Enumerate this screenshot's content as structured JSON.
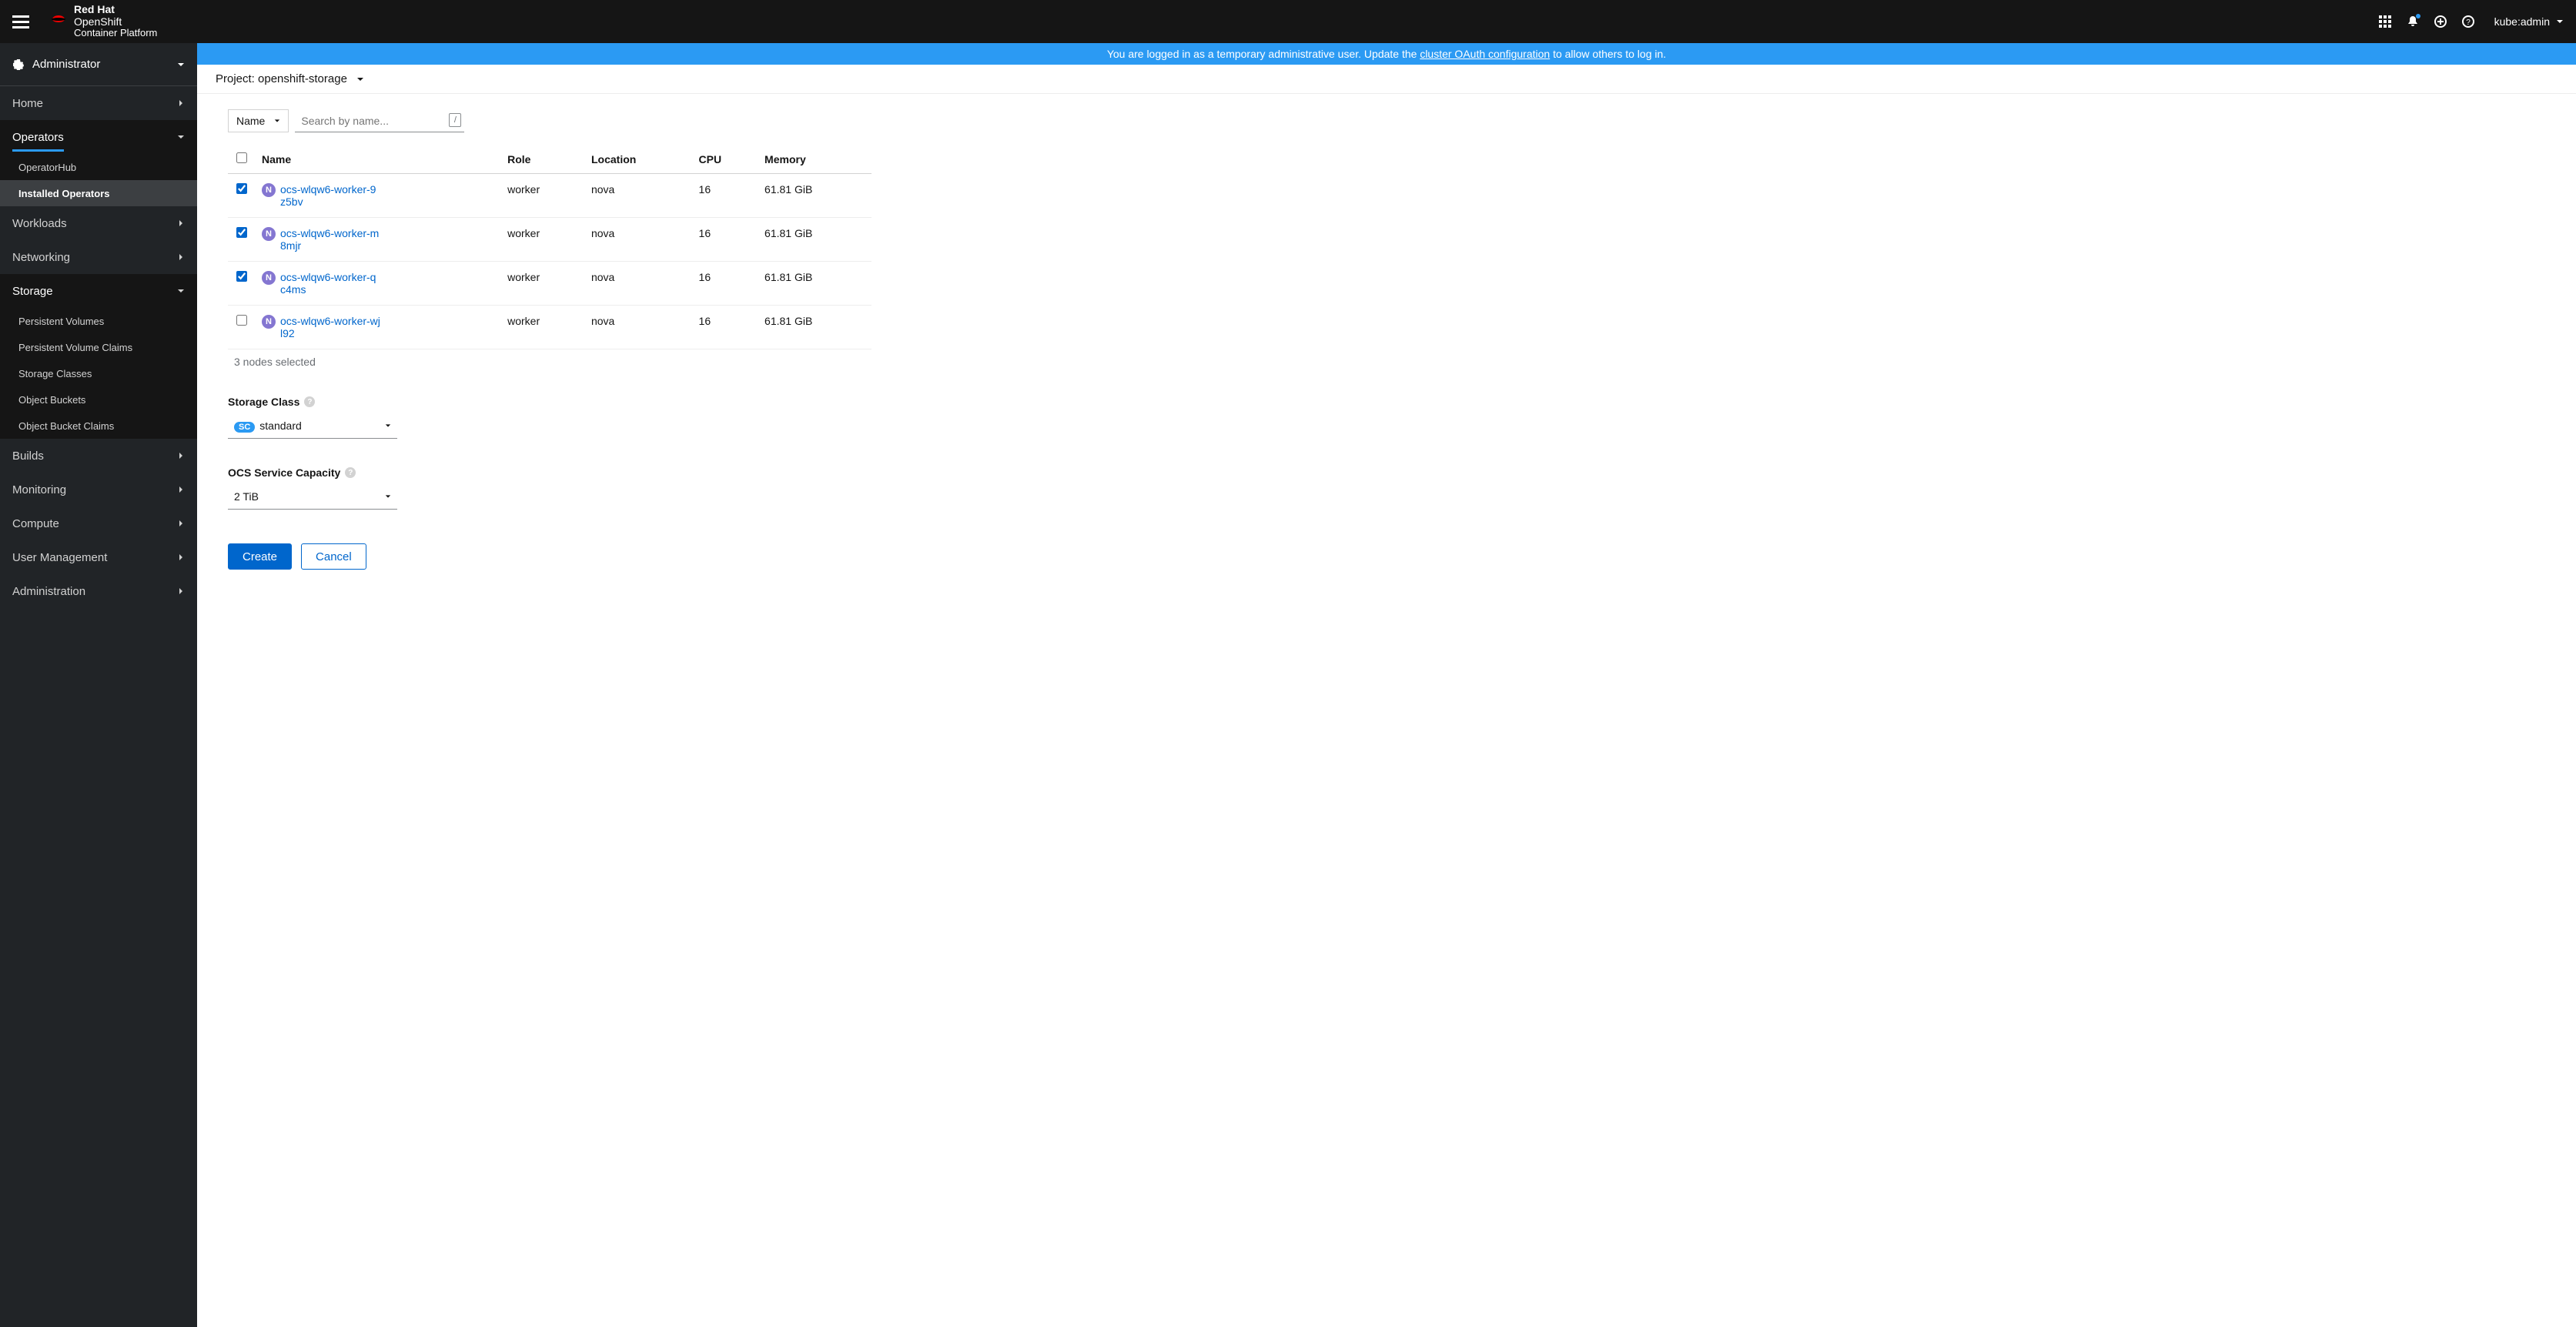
{
  "masthead": {
    "brand_line1_bold": "Red Hat",
    "brand_line1_reg": "OpenShift",
    "brand_line2": "Container Platform",
    "user": "kube:admin"
  },
  "notification": {
    "prefix": "You are logged in as a temporary administrative user. Update the ",
    "link": "cluster OAuth configuration",
    "suffix": " to allow others to log in."
  },
  "sidebar": {
    "perspective": "Administrator",
    "items": [
      {
        "label": "Home",
        "expanded": false
      },
      {
        "label": "Operators",
        "expanded": true,
        "children": [
          {
            "label": "OperatorHub",
            "active": false
          },
          {
            "label": "Installed Operators",
            "active": true
          }
        ]
      },
      {
        "label": "Workloads",
        "expanded": false
      },
      {
        "label": "Networking",
        "expanded": false
      },
      {
        "label": "Storage",
        "expanded": true,
        "children": [
          {
            "label": "Persistent Volumes"
          },
          {
            "label": "Persistent Volume Claims"
          },
          {
            "label": "Storage Classes"
          },
          {
            "label": "Object Buckets"
          },
          {
            "label": "Object Bucket Claims"
          }
        ]
      },
      {
        "label": "Builds",
        "expanded": false
      },
      {
        "label": "Monitoring",
        "expanded": false
      },
      {
        "label": "Compute",
        "expanded": false
      },
      {
        "label": "User Management",
        "expanded": false
      },
      {
        "label": "Administration",
        "expanded": false
      }
    ]
  },
  "project": {
    "label": "Project: openshift-storage"
  },
  "filter": {
    "type": "Name",
    "placeholder": "Search by name..."
  },
  "table": {
    "headers": [
      "Name",
      "Role",
      "Location",
      "CPU",
      "Memory"
    ],
    "rows": [
      {
        "checked": true,
        "name": "ocs-wlqw6-worker-9z5bv",
        "role": "worker",
        "location": "nova",
        "cpu": "16",
        "memory": "61.81 GiB"
      },
      {
        "checked": true,
        "name": "ocs-wlqw6-worker-m8mjr",
        "role": "worker",
        "location": "nova",
        "cpu": "16",
        "memory": "61.81 GiB"
      },
      {
        "checked": true,
        "name": "ocs-wlqw6-worker-qc4ms",
        "role": "worker",
        "location": "nova",
        "cpu": "16",
        "memory": "61.81 GiB"
      },
      {
        "checked": false,
        "name": "ocs-wlqw6-worker-wjl92",
        "role": "worker",
        "location": "nova",
        "cpu": "16",
        "memory": "61.81 GiB"
      }
    ],
    "selected_text": "3 nodes selected"
  },
  "storage_class": {
    "label": "Storage Class",
    "badge": "SC",
    "value": "standard"
  },
  "capacity": {
    "label": "OCS Service Capacity",
    "value": "2 TiB"
  },
  "buttons": {
    "create": "Create",
    "cancel": "Cancel"
  }
}
